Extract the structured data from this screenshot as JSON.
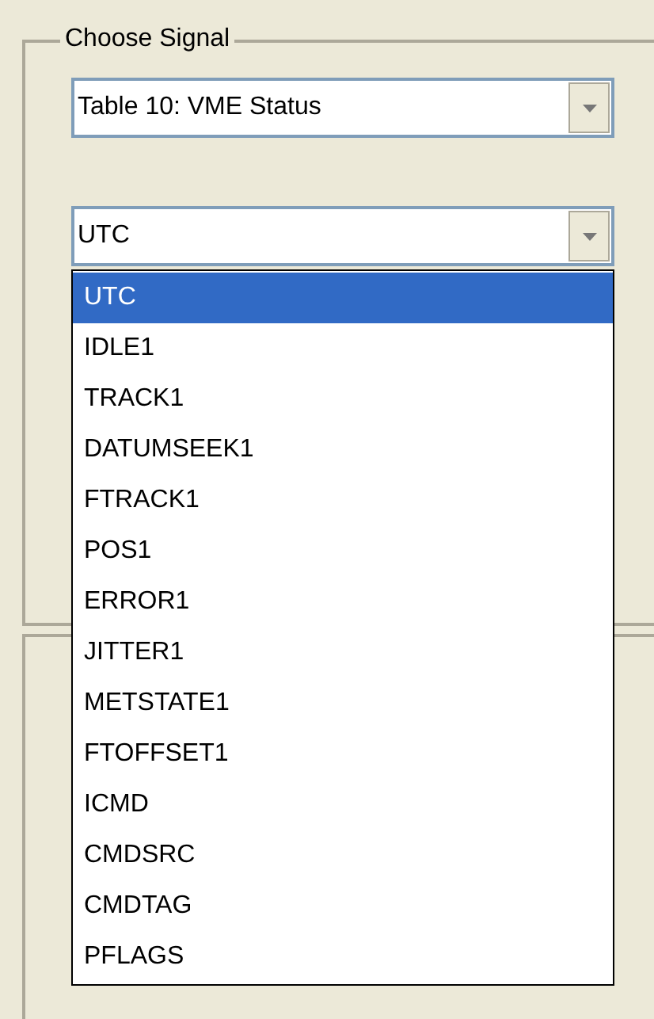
{
  "group": {
    "title": "Choose Signal"
  },
  "table_combo": {
    "value": "Table 10: VME Status"
  },
  "signal_combo": {
    "value": "UTC"
  },
  "dropdown_items": [
    {
      "label": "UTC",
      "selected": true
    },
    {
      "label": "IDLE1",
      "selected": false
    },
    {
      "label": "TRACK1",
      "selected": false
    },
    {
      "label": "DATUMSEEK1",
      "selected": false
    },
    {
      "label": "FTRACK1",
      "selected": false
    },
    {
      "label": "POS1",
      "selected": false
    },
    {
      "label": "ERROR1",
      "selected": false
    },
    {
      "label": "JITTER1",
      "selected": false
    },
    {
      "label": "METSTATE1",
      "selected": false
    },
    {
      "label": "FTOFFSET1",
      "selected": false
    },
    {
      "label": "ICMD",
      "selected": false
    },
    {
      "label": "CMDSRC",
      "selected": false
    },
    {
      "label": "CMDTAG",
      "selected": false
    },
    {
      "label": "PFLAGS",
      "selected": false
    }
  ]
}
